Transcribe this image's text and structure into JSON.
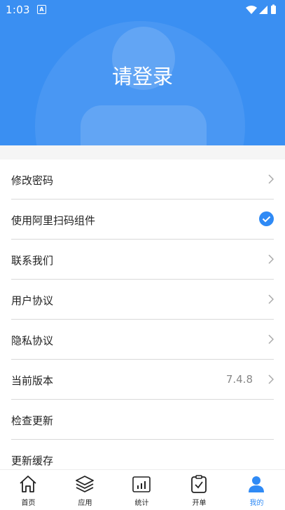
{
  "status": {
    "time": "1:03",
    "notif": "A"
  },
  "header": {
    "login_text": "请登录"
  },
  "menu": {
    "change_password": "修改密码",
    "ali_scan": "使用阿里扫码组件",
    "contact_us": "联系我们",
    "user_agreement": "用户协议",
    "privacy_agreement": "隐私协议",
    "current_version": "当前版本",
    "version_value": "7.4.8",
    "check_update": "检查更新",
    "update_cache": "更新缓存"
  },
  "tabs": [
    {
      "label": "首页",
      "icon": "home-icon"
    },
    {
      "label": "应用",
      "icon": "layers-icon"
    },
    {
      "label": "统计",
      "icon": "stats-icon"
    },
    {
      "label": "开单",
      "icon": "clipboard-check-icon"
    },
    {
      "label": "我的",
      "icon": "user-icon"
    }
  ],
  "colors": {
    "accent": "#3a8ff2",
    "active_tab": "#2f8af5"
  }
}
